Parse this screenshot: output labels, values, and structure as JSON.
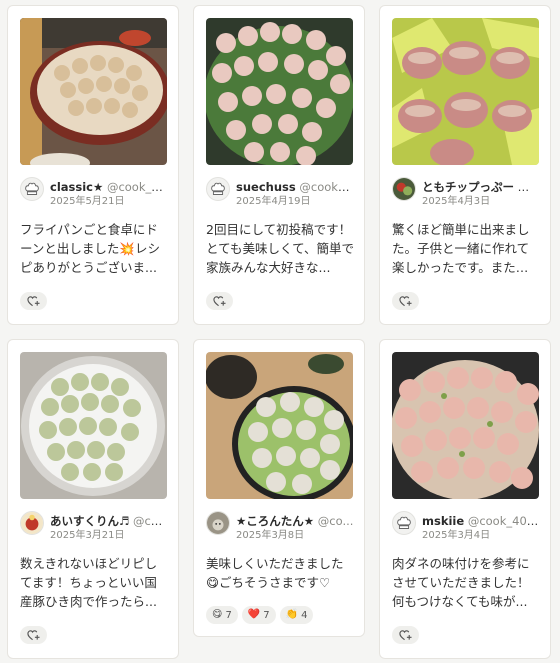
{
  "cards": [
    {
      "name": "classic★",
      "handle": "@cook_40...",
      "date": "2025年5月21日",
      "comment": "フライパンごと食卓にドーンと出しました💥レシピありがとうございま..."
    },
    {
      "name": "suechuss",
      "handle": "@cook_40...",
      "date": "2025年4月19日",
      "comment": "2回目にして初投稿です！とても美味しくて、簡単で家族みんな大好きな..."
    },
    {
      "name": "ともチップっぷー",
      "handle": "@...",
      "date": "2025年4月3日",
      "comment": "驚くほど簡単に出来ました。子供と一緒に作れて楽しかったです。またリ..."
    },
    {
      "name": "あいすくりん♬",
      "handle": "@co...",
      "date": "2025年3月21日",
      "comment": "数えきれないほどリピしてます！ちょっといい国産豚ひき肉で作ったら..."
    },
    {
      "name": "★ころんたん★",
      "handle": "@co...",
      "date": "2025年3月8日",
      "comment": "美味しくいただきました😋ごちそうさまです♡",
      "reactions": [
        {
          "emoji": "😋",
          "count": "7"
        },
        {
          "emoji": "❤️",
          "count": "7"
        },
        {
          "emoji": "👏",
          "count": "4"
        }
      ]
    },
    {
      "name": "mskiie",
      "handle": "@cook_4048...",
      "date": "2025年3月4日",
      "comment": "肉ダネの味付けを参考にさせていただきました！何もつけなくても味が..."
    }
  ],
  "ui": {
    "react_button_icon": "add-reaction-icon",
    "default_avatar_icon": "chef-hat-icon"
  }
}
